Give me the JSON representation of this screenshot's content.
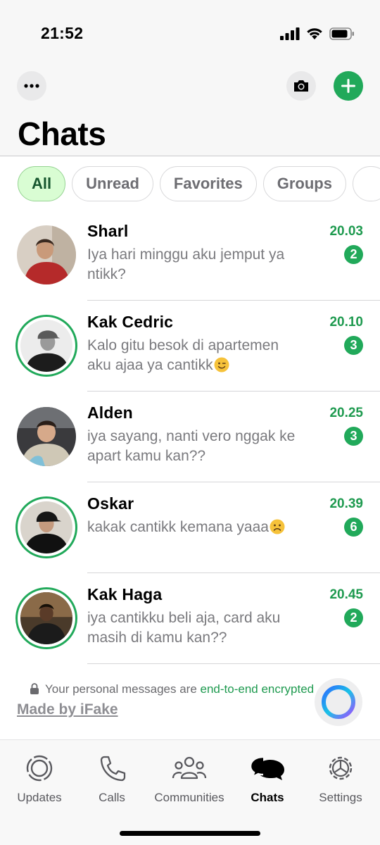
{
  "status_bar": {
    "time": "21:52"
  },
  "header": {
    "title": "Chats",
    "more_icon": "ellipsis-icon",
    "camera_icon": "camera-icon",
    "new_chat_icon": "plus-icon"
  },
  "filters": [
    {
      "label": "All",
      "active": true
    },
    {
      "label": "Unread",
      "active": false
    },
    {
      "label": "Favorites",
      "active": false
    },
    {
      "label": "Groups",
      "active": false
    }
  ],
  "chats": [
    {
      "name": "Sharl",
      "preview": "Iya hari minggu aku jemput ya ntikk?",
      "time": "20.03",
      "unread": "2",
      "has_status": false
    },
    {
      "name": "Kak Cedric",
      "preview": "Kalo gitu besok di apartemen aku ajaa ya cantikk",
      "emoji": "winking-face",
      "time": "20.10",
      "unread": "3",
      "has_status": true
    },
    {
      "name": "Alden",
      "preview": "iya sayang, nanti vero nggak ke apart kamu kan??",
      "time": "20.25",
      "unread": "3",
      "has_status": false
    },
    {
      "name": "Oskar",
      "preview": "kakak cantikk kemana yaaa",
      "emoji": "frowning-face",
      "time": "20.39",
      "unread": "6",
      "has_status": true
    },
    {
      "name": "Kak Haga",
      "preview": "iya cantikku beli aja, card aku masih di kamu kan??",
      "time": "20.45",
      "unread": "2",
      "has_status": true
    }
  ],
  "footer": {
    "encryption_text": "Your personal messages are ",
    "encryption_link": "end-to-end encrypted",
    "watermark": "Made by iFake"
  },
  "tabbar": [
    {
      "label": "Updates",
      "icon": "updates-icon",
      "active": false
    },
    {
      "label": "Calls",
      "icon": "phone-icon",
      "active": false
    },
    {
      "label": "Communities",
      "icon": "communities-icon",
      "active": false
    },
    {
      "label": "Chats",
      "icon": "chats-icon",
      "active": true
    },
    {
      "label": "Settings",
      "icon": "gear-icon",
      "active": false
    }
  ],
  "colors": {
    "accent": "#21a95a",
    "accent_text": "#1e9a4f",
    "chip_active_bg": "#d9fdd3",
    "muted_text": "#7a7a7e"
  }
}
